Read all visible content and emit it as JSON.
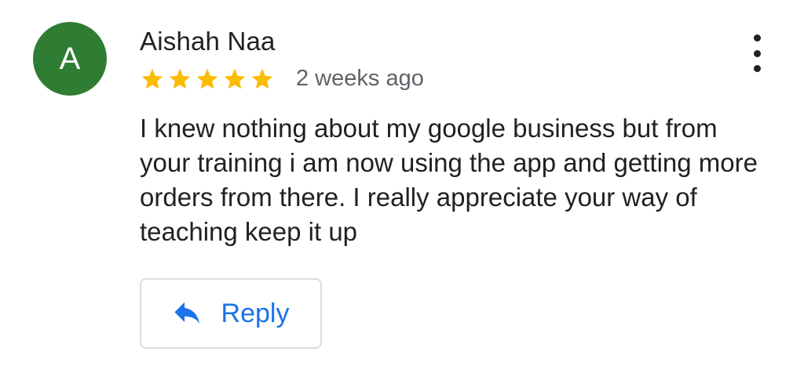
{
  "review": {
    "avatar_letter": "A",
    "avatar_color": "#2e7d32",
    "author_name": "Aishah Naa",
    "rating": 5,
    "rating_max": 5,
    "star_color": "#fbbc04",
    "time_ago": "2 weeks ago",
    "text": "I knew nothing about my google business but from your training i am now using the app and getting more orders from there. I really appreciate your way of teaching keep it up",
    "reply_label": "Reply",
    "reply_color": "#1a73e8",
    "icons": {
      "more": "more-vert-icon",
      "reply": "reply-arrow-icon",
      "star": "star-icon"
    }
  }
}
